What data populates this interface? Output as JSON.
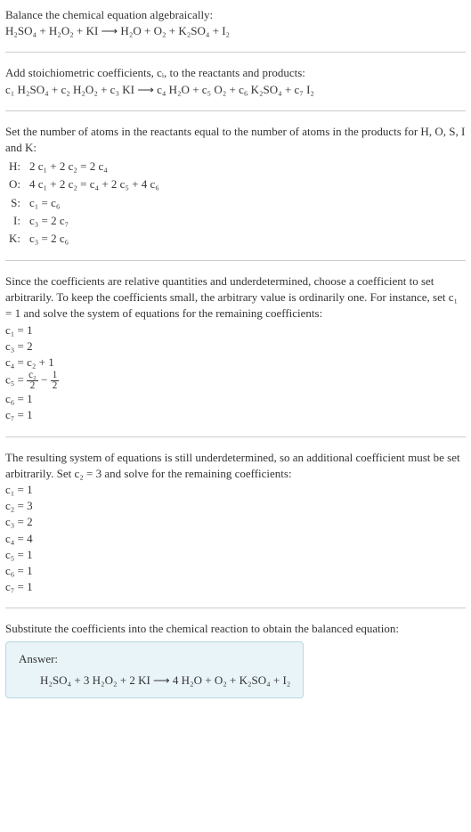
{
  "intro": {
    "line1": "Balance the chemical equation algebraically:",
    "eq1": "H₂SO₄ + H₂O₂ + KI ⟶ H₂O + O₂ + K₂SO₄ + I₂"
  },
  "stoich": {
    "text": "Add stoichiometric coefficients, cᵢ, to the reactants and products:",
    "eq": "c₁ H₂SO₄ + c₂ H₂O₂ + c₃ KI ⟶ c₄ H₂O + c₅ O₂ + c₆ K₂SO₄ + c₇ I₂"
  },
  "atoms": {
    "text": "Set the number of atoms in the reactants equal to the number of atoms in the products for H, O, S, I and K:",
    "rows": [
      {
        "el": "H:",
        "eq": "2 c₁ + 2 c₂ = 2 c₄"
      },
      {
        "el": "O:",
        "eq": "4 c₁ + 2 c₂ = c₄ + 2 c₅ + 4 c₆"
      },
      {
        "el": "S:",
        "eq": "c₁ = c₆"
      },
      {
        "el": "I:",
        "eq": "c₃ = 2 c₇"
      },
      {
        "el": "K:",
        "eq": "c₃ = 2 c₆"
      }
    ]
  },
  "underdet1": {
    "text": "Since the coefficients are relative quantities and underdetermined, choose a coefficient to set arbitrarily. To keep the coefficients small, the arbitrary value is ordinarily one. For instance, set c₁ = 1 and solve the system of equations for the remaining coefficients:",
    "lines": [
      "c₁ = 1",
      "c₃ = 2",
      "c₄ = c₂ + 1"
    ],
    "c5_lhs": "c₅ = ",
    "c5_frac1_num": "c₂",
    "c5_frac1_den": "2",
    "c5_minus": " − ",
    "c5_frac2_num": "1",
    "c5_frac2_den": "2",
    "lines2": [
      "c₆ = 1",
      "c₇ = 1"
    ]
  },
  "underdet2": {
    "text": "The resulting system of equations is still underdetermined, so an additional coefficient must be set arbitrarily. Set c₂ = 3 and solve for the remaining coefficients:",
    "lines": [
      "c₁ = 1",
      "c₂ = 3",
      "c₃ = 2",
      "c₄ = 4",
      "c₅ = 1",
      "c₆ = 1",
      "c₇ = 1"
    ]
  },
  "final": {
    "text": "Substitute the coefficients into the chemical reaction to obtain the balanced equation:"
  },
  "answer": {
    "label": "Answer:",
    "eq": "H₂SO₄ + 3 H₂O₂ + 2 KI ⟶ 4 H₂O + O₂ + K₂SO₄ + I₂"
  }
}
